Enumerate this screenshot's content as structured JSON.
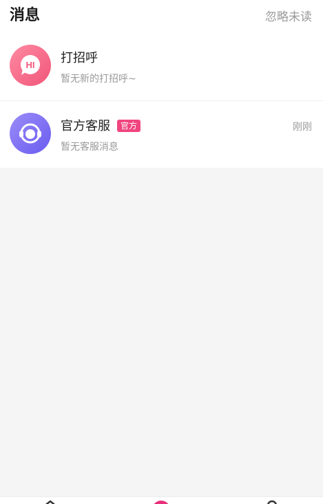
{
  "header": {
    "title": "消息",
    "action_label": "忽略未读"
  },
  "conversations": [
    {
      "title": "打招呼",
      "subtitle": "暂无新的打招呼~",
      "avatar_icon": "hi-bubble-icon",
      "avatar_color": "#f0567a"
    },
    {
      "title": "官方客服",
      "badge": "官方",
      "subtitle": "暂无客服消息",
      "time": "刚刚",
      "avatar_icon": "headset-icon",
      "avatar_color": "#6b5cf0",
      "badge_color": "#f0457f"
    }
  ],
  "tabbar": {
    "icons": [
      "home-icon",
      "center-tab-icon",
      "profile-icon"
    ],
    "accent_color": "#e8307a"
  }
}
